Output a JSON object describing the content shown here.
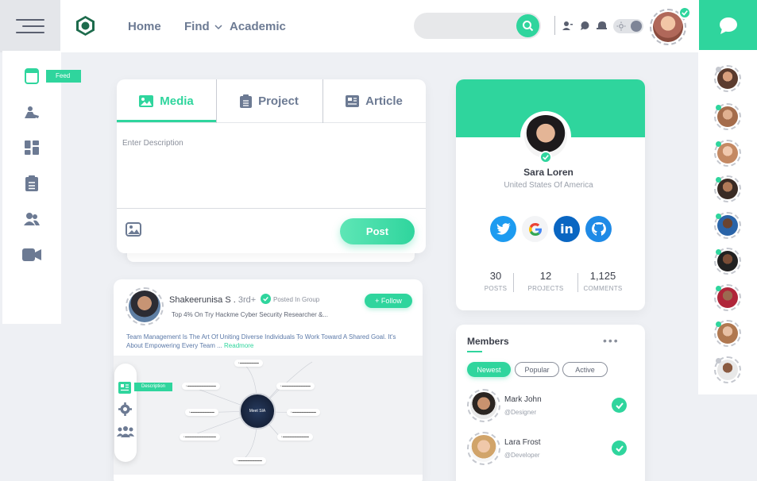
{
  "header": {
    "nav": [
      "Home",
      "Find",
      "Academic"
    ],
    "search_placeholder": ""
  },
  "sidebar": {
    "items": [
      {
        "icon": "feed-icon",
        "tooltip": "Feed"
      },
      {
        "icon": "academic-icon"
      },
      {
        "icon": "dashboard-icon"
      },
      {
        "icon": "clipboard-icon"
      },
      {
        "icon": "people-icon"
      },
      {
        "icon": "video-icon"
      }
    ]
  },
  "composer": {
    "tabs": [
      "Media",
      "Project",
      "Article"
    ],
    "placeholder": "Enter Description",
    "post_label": "Post"
  },
  "feed_post": {
    "author": "Shakeerunisa S .",
    "degree": "3rd+",
    "posted_in": "Posted In Group",
    "subtitle": "Top 4% On Try Hackme Cyber Security Researcher &...",
    "follow_label": "+ Follow",
    "text": "Team Management Is The Art Of Uniting Diverse Individuals To Work Toward A Shared Goal. It's About Empowering Every Team ...",
    "readmore": "Readmore",
    "tooltip": "Description",
    "mindmap_center": "Meet SIA"
  },
  "profile": {
    "name": "Sara Loren",
    "location": "United States Of America",
    "social": [
      "twitter-icon",
      "google-icon",
      "linkedin-icon",
      "github-icon"
    ],
    "stats": [
      {
        "value": "30",
        "label": "POSTS"
      },
      {
        "value": "12",
        "label": "PROJECTS"
      },
      {
        "value": "1,125",
        "label": "COMMENTS"
      }
    ]
  },
  "members": {
    "title": "Members",
    "filters": [
      "Newest",
      "Popular",
      "Active"
    ],
    "list": [
      {
        "name": "Mark John",
        "role": "@Designer"
      },
      {
        "name": "Lara Frost",
        "role": "@Developer"
      }
    ]
  },
  "colors": {
    "accent": "#2fd59d",
    "nav_text": "#6c7a93",
    "background": "#eef0f4"
  }
}
